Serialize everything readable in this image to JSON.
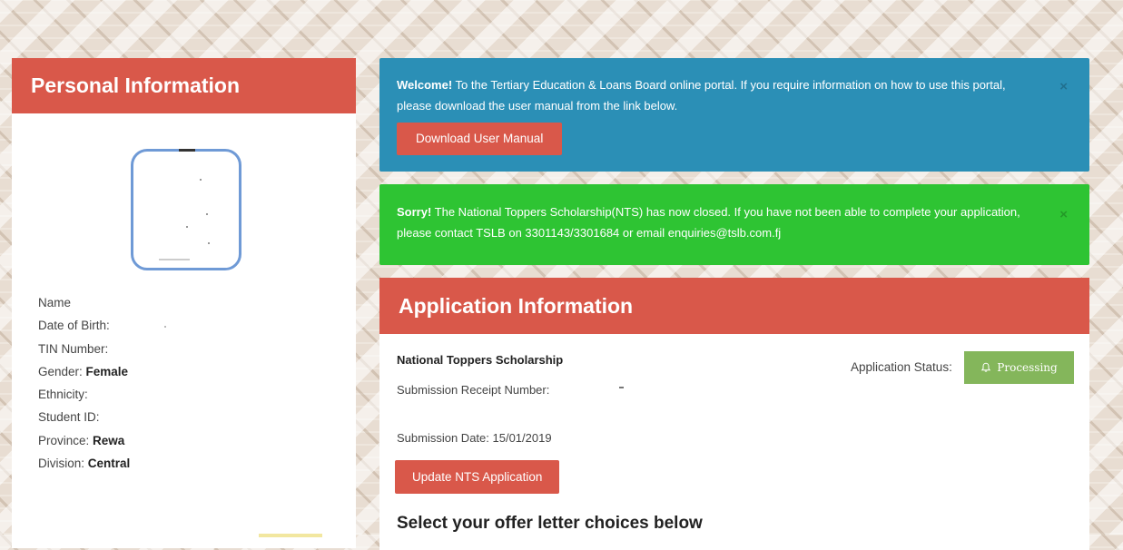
{
  "personal": {
    "title": "Personal Information",
    "fields": [
      {
        "label": "Name",
        "value": ""
      },
      {
        "label": "Date of Birth:",
        "value": ""
      },
      {
        "label": "TIN Number:",
        "value": ""
      },
      {
        "label": "Gender: ",
        "value": "Female"
      },
      {
        "label": "Ethnicity:",
        "value": ""
      },
      {
        "label": "Student ID:",
        "value": ""
      },
      {
        "label": "Province: ",
        "value": "Rewa"
      },
      {
        "label": "Division: ",
        "value": "Central"
      }
    ]
  },
  "alerts": {
    "welcome": {
      "strong": "Welcome!",
      "text": " To the Tertiary Education & Loans Board online portal. If you require information on how to use this portal, please download the user manual from the link below.",
      "button": "Download User Manual",
      "close": "×"
    },
    "closed": {
      "strong": "Sorry!",
      "text": " The National Toppers Scholarship(NTS) has now closed. If you have not been able to complete your application, please contact TSLB on 3301143/3301684 or email enquiries@tslb.com.fj",
      "close": "×"
    }
  },
  "application": {
    "title": "Application Information",
    "scholarship": "National Toppers Scholarship",
    "receipt_label": "Submission Receipt Number:",
    "status_label": "Application Status:",
    "status_value": "Processing",
    "date_label": "Submission Date: 15/01/2019",
    "update_button": "Update NTS Application",
    "offer_heading": "Select your offer letter choices below"
  },
  "colors": {
    "header_red": "#d9584a",
    "info_blue": "#2b8fb6",
    "success_green": "#2ec433",
    "status_green": "#84b65b",
    "avatar_border": "#6f9ad6"
  },
  "icons": {
    "status": "bell-icon",
    "dismiss": "close-icon"
  }
}
